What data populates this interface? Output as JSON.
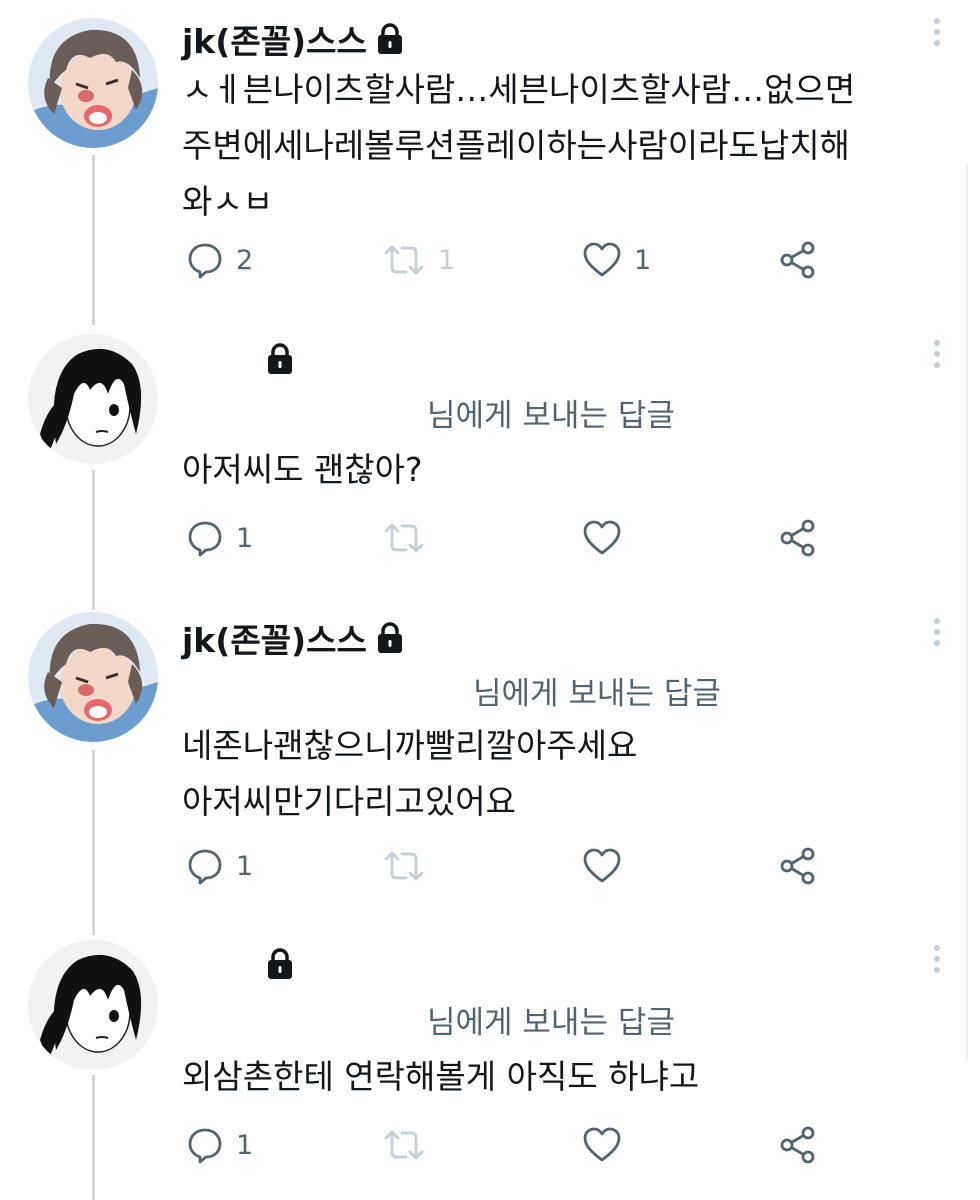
{
  "tweets": [
    {
      "username": "jk(존꼴)스스",
      "reply_to_label": "",
      "text": "ㅅㅔ븐나이츠할사람…세븐나이츠할사람…없으면\n주변에세나레볼루션플레이하는사람이라도납치해\n와ㅅㅂ",
      "counts": {
        "reply": "2",
        "retweet": "1",
        "like": "1"
      }
    },
    {
      "username": "",
      "reply_to_label": "님에게 보내는 답글",
      "text": "아저씨도 괜찮아?",
      "counts": {
        "reply": "1",
        "retweet": "",
        "like": ""
      }
    },
    {
      "username": "jk(존꼴)스스",
      "reply_to_label": "님에게 보내는 답글",
      "text": "네존나괜찮으니까빨리깔아주세요\n아저씨만기다리고있어요",
      "counts": {
        "reply": "1",
        "retweet": "",
        "like": ""
      }
    },
    {
      "username": "",
      "reply_to_label": "님에게 보내는 답글",
      "text": "외삼촌한테 연락해볼게 아직도 하냐고",
      "counts": {
        "reply": "1",
        "retweet": "",
        "like": ""
      }
    }
  ],
  "icons": {
    "reply": "reply-icon",
    "retweet": "retweet-icon",
    "like": "heart-icon",
    "share": "share-icon",
    "lock": "lock-icon",
    "more": "more-vertical-icon"
  },
  "colors": {
    "text": "#14171a",
    "secondary": "#536471",
    "faint": "#c4cfd6",
    "thread_line": "#cfd9de"
  }
}
